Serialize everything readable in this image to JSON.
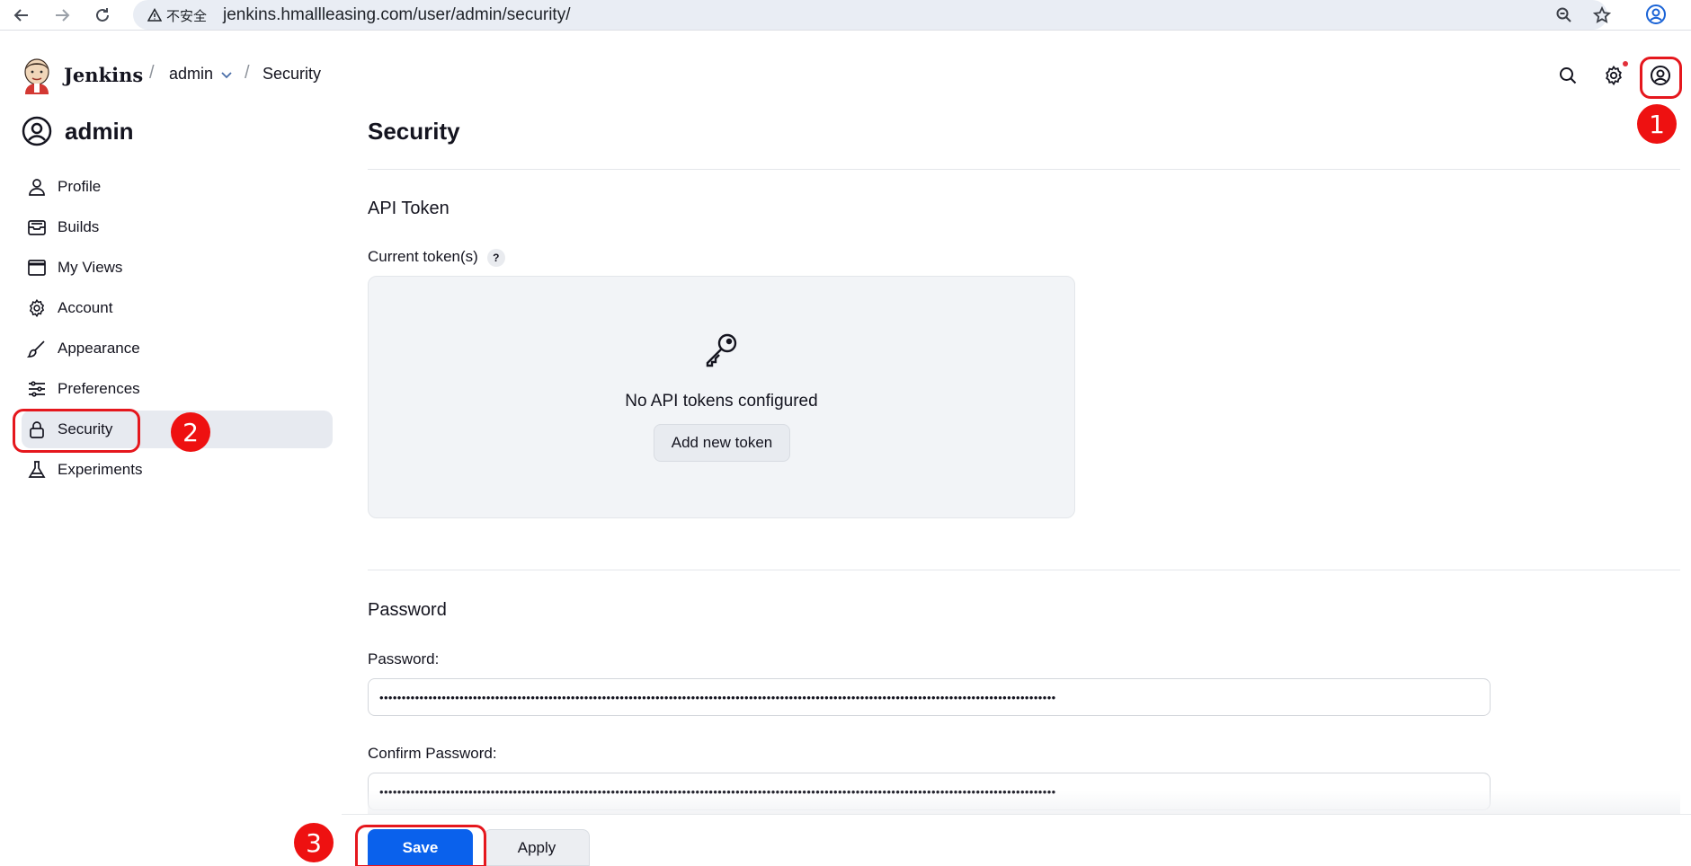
{
  "browser": {
    "insecure_label": "不安全",
    "url": "jenkins.hmallleasing.com/user/admin/security/"
  },
  "header": {
    "brand": "Jenkins",
    "breadcrumbs": [
      "admin",
      "Security"
    ]
  },
  "sidebar": {
    "title": "admin",
    "items": [
      {
        "label": "Profile",
        "icon": "person-icon"
      },
      {
        "label": "Builds",
        "icon": "builds-icon"
      },
      {
        "label": "My Views",
        "icon": "window-icon"
      },
      {
        "label": "Account",
        "icon": "gear-icon"
      },
      {
        "label": "Appearance",
        "icon": "brush-icon"
      },
      {
        "label": "Preferences",
        "icon": "sliders-icon"
      },
      {
        "label": "Security",
        "icon": "lock-icon",
        "active": true
      },
      {
        "label": "Experiments",
        "icon": "flask-icon"
      }
    ]
  },
  "main": {
    "title": "Security",
    "api_token": {
      "section_title": "API Token",
      "current_label": "Current token(s)",
      "help": "?",
      "empty_text": "No API tokens configured",
      "add_button": "Add new token"
    },
    "password": {
      "section_title": "Password",
      "password_label": "Password:",
      "password_value": "••••••••••••••••••••••••••••••••••••••••••••••••••••••••••••••••••••••••••••••••••••••••••••••••••••••••••••••••••••••••••••••••••••••••••••••••••••••••",
      "confirm_label": "Confirm Password:",
      "confirm_value": "••••••••••••••••••••••••••••••••••••••••••••••••••••••••••••••••••••••••••••••••••••••••••••••••••••••••••••••••••••••••••••••••••••••••••••••••••••••••"
    },
    "buttons": {
      "save": "Save",
      "apply": "Apply"
    }
  },
  "annotations": [
    "1",
    "2",
    "3"
  ],
  "colors": {
    "accent": "#0a61ec",
    "annotation": "#ee1111",
    "active_bg": "#e7eaf0"
  }
}
